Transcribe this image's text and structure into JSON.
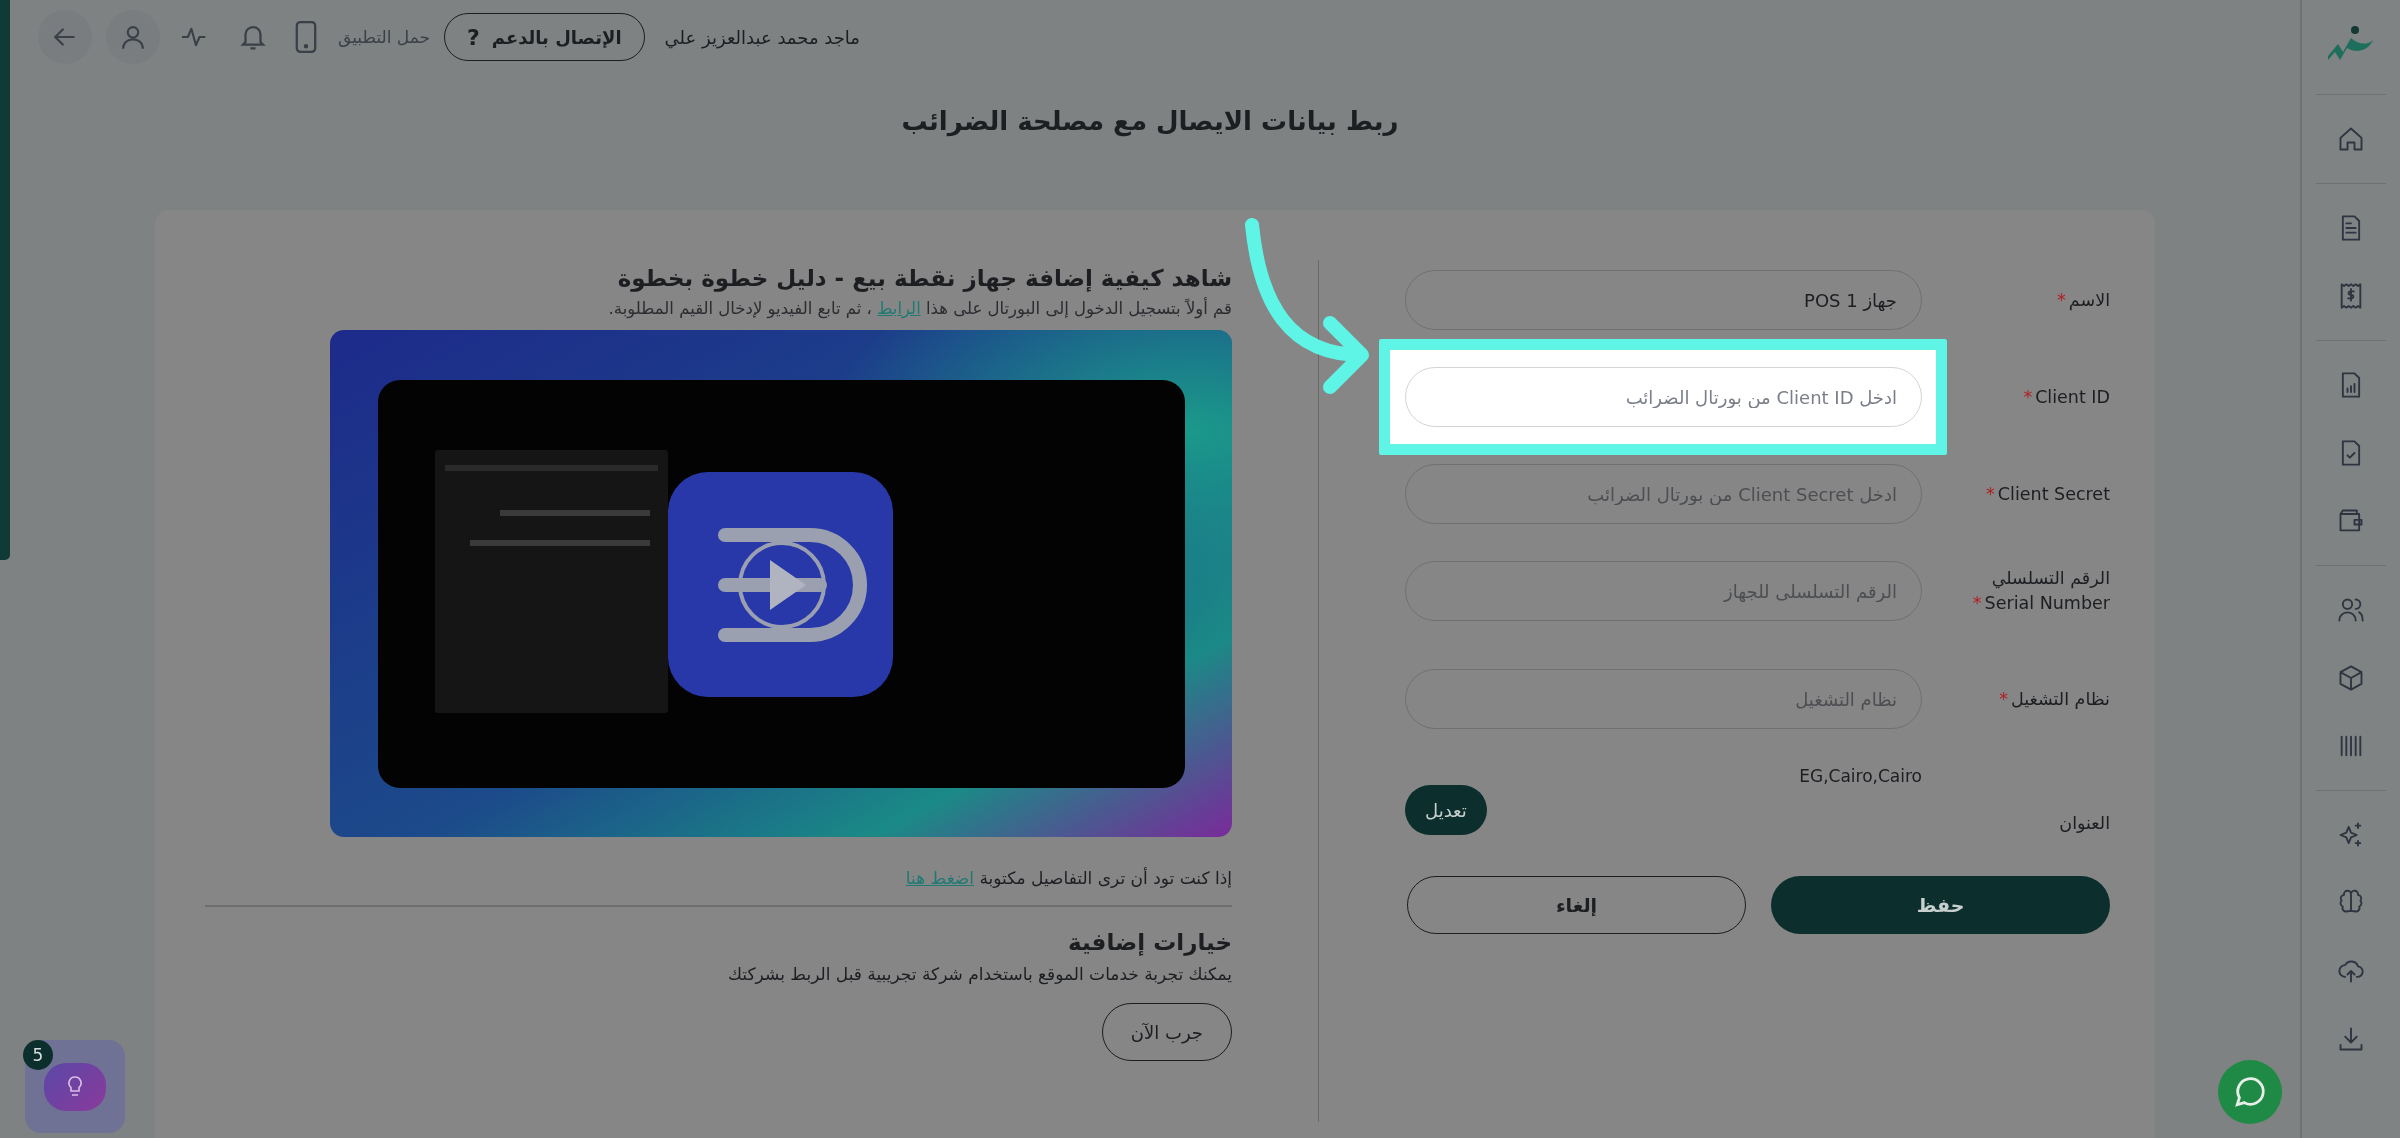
{
  "top_bar": {
    "user_name": "ماجد محمد عبدالعزيز علي",
    "support_button": {
      "label": "الإتصال بالدعم",
      "icon": "?"
    },
    "download_app": "حمل التطبيق"
  },
  "page_title": "ربط بيانات الايصال مع مصلحة الضرائب",
  "video_guide": {
    "title": "شاهد كيفية إضافة جهاز نقطة بيع - دليل خطوة بخطوة",
    "intro_before": "قم أولاً بتسجيل الدخول إلى البورتال على هذا",
    "intro_link": "الرابط",
    "intro_after": "، ثم تابع الفيديو لإدخال القيم المطلوبة.",
    "written_note": "إذا كنت تود أن ترى التفاصيل مكتوبة",
    "written_link": "اضغط هنا"
  },
  "extra_options": {
    "title": "خيارات إضافية",
    "description": "يمكنك تجربة خدمات الموقع باستخدام شركة تجريبية قبل الربط بشركتك",
    "button": "جرب الآن"
  },
  "form": {
    "fields": [
      {
        "label": "الاسم",
        "required_mark": "*",
        "value": "جهاز POS 1",
        "highlighted": false
      },
      {
        "label": "Client ID",
        "required_mark": "*",
        "placeholder": "ادخل Client ID من بورتال الضرائب",
        "highlighted": true
      },
      {
        "label": "Client Secret",
        "required_mark": "*",
        "placeholder": "ادخل Client Secret من بورتال الضرائب",
        "highlighted": false
      },
      {
        "label": "الرقم التسلسلي",
        "sublabel": "Serial Number",
        "required_mark": "*",
        "placeholder": "الرقم التسلسلى للجهاز",
        "highlighted": false
      },
      {
        "label": "نظام التشغيل",
        "required_mark": "*",
        "placeholder": "نظام التشغيل",
        "highlighted": false
      }
    ],
    "address": {
      "label": "العنوان",
      "value": "EG,Cairo,Cairo",
      "edit_button": "تعديل"
    },
    "save_button": "حفظ",
    "cancel_button": "إلغاء"
  },
  "help_widget": {
    "badge": "5"
  }
}
